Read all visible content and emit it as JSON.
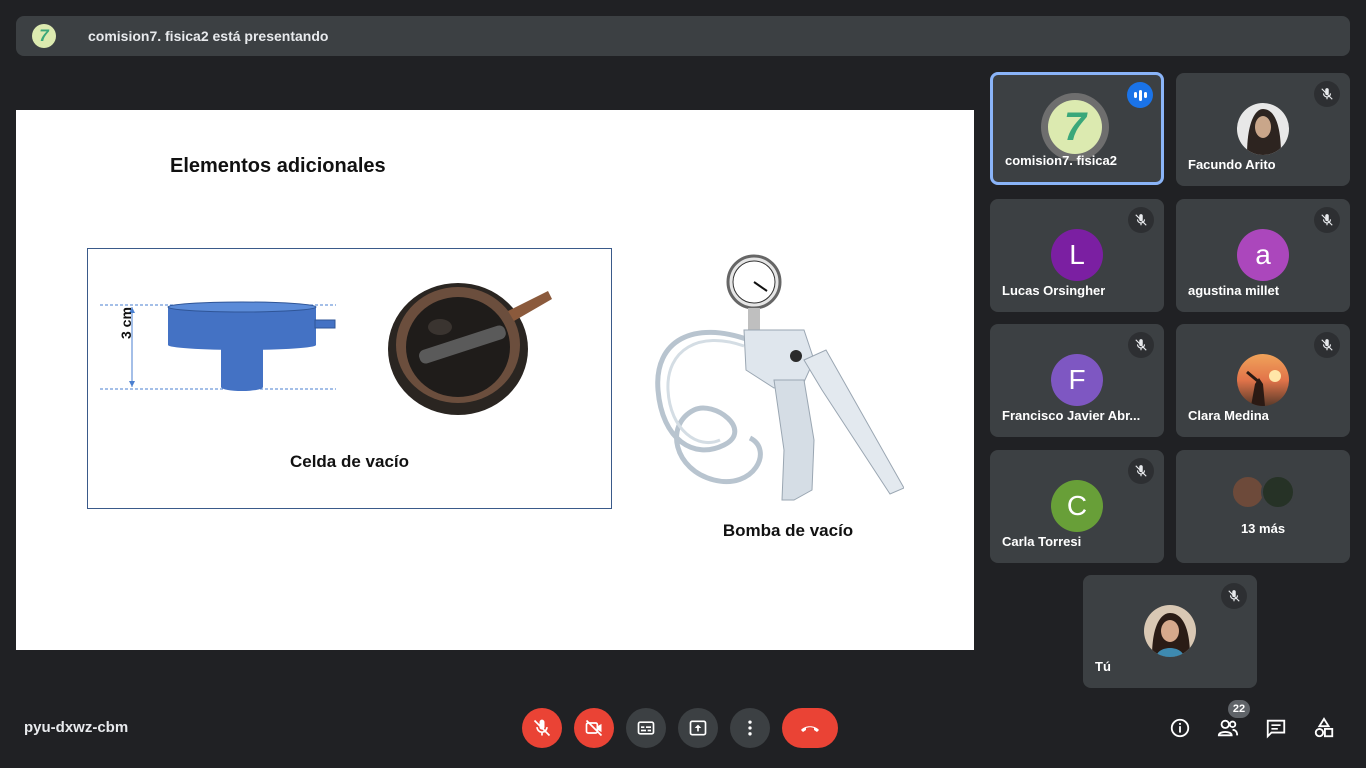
{
  "presenting_bar": {
    "text": "comision7. fisica2 está presentando",
    "avatar_glyph": "7"
  },
  "slide": {
    "title": "Elementos adicionales",
    "cell_caption": "Celda de vacío",
    "dimension_label": "3 cm",
    "pump_caption": "Bomba de vacío"
  },
  "participants": [
    {
      "name": "comision7. fisica2",
      "avatar": "7",
      "avatar_color": "#dceab0",
      "state": "speaking"
    },
    {
      "name": "Facundo Arito",
      "avatar": "photo",
      "state": "muted"
    },
    {
      "name": "Lucas Orsingher",
      "avatar": "L",
      "avatar_color": "#7b1fa2",
      "state": "muted"
    },
    {
      "name": "agustina millet",
      "avatar": "a",
      "avatar_color": "#ab47bc",
      "state": "muted"
    },
    {
      "name": "Francisco Javier Abr...",
      "avatar": "F",
      "avatar_color": "#7e57c2",
      "state": "muted"
    },
    {
      "name": "Clara Medina",
      "avatar": "photo",
      "state": "muted"
    },
    {
      "name": "Carla Torresi",
      "avatar": "C",
      "avatar_color": "#689f38",
      "state": "muted"
    },
    {
      "name": "13 más",
      "avatar": "group"
    },
    {
      "name": "Tú",
      "avatar": "photo",
      "state": "muted"
    }
  ],
  "bottom_bar": {
    "meeting_code": "pyu-dxwz-cbm",
    "people_count": "22"
  },
  "colors": {
    "background": "#202124",
    "tile": "#3c4043",
    "danger": "#ea4335",
    "active_border": "#8ab4f8",
    "speaking": "#1a73e8"
  }
}
